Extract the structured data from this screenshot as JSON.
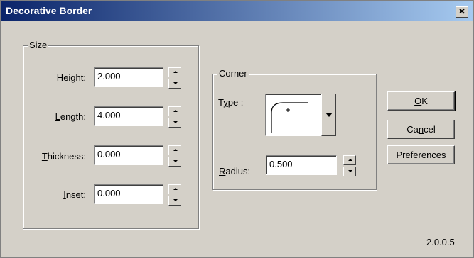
{
  "window": {
    "title": "Decorative Border",
    "close_glyph": "✕"
  },
  "size_group": {
    "legend": "Size",
    "fields": [
      {
        "label_pre": "",
        "label_ul": "H",
        "label_post": "eight:",
        "value": "2.000"
      },
      {
        "label_pre": "",
        "label_ul": "L",
        "label_post": "ength:",
        "value": "4.000"
      },
      {
        "label_pre": "",
        "label_ul": "T",
        "label_post": "hickness:",
        "value": "0.000"
      },
      {
        "label_pre": "",
        "label_ul": "I",
        "label_post": "nset:",
        "value": "0.000"
      }
    ]
  },
  "corner_group": {
    "legend": "Corner",
    "type_label_pre": "T",
    "type_label_ul": "y",
    "type_label_post": "pe :",
    "type_icon": "rounded-corner-icon",
    "radius_label_ul": "R",
    "radius_label_post": "adius:",
    "radius_value": "0.500"
  },
  "buttons": {
    "ok_ul": "O",
    "ok_post": "K",
    "cancel_pre": "Ca",
    "cancel_ul": "n",
    "cancel_post": "cel",
    "prefs_pre": "Pr",
    "prefs_ul": "e",
    "prefs_post": "ferences"
  },
  "version": "2.0.0.5",
  "colors": {
    "titlebar_start": "#0a246a",
    "titlebar_end": "#a6caf0",
    "face": "#d4d0c8"
  }
}
